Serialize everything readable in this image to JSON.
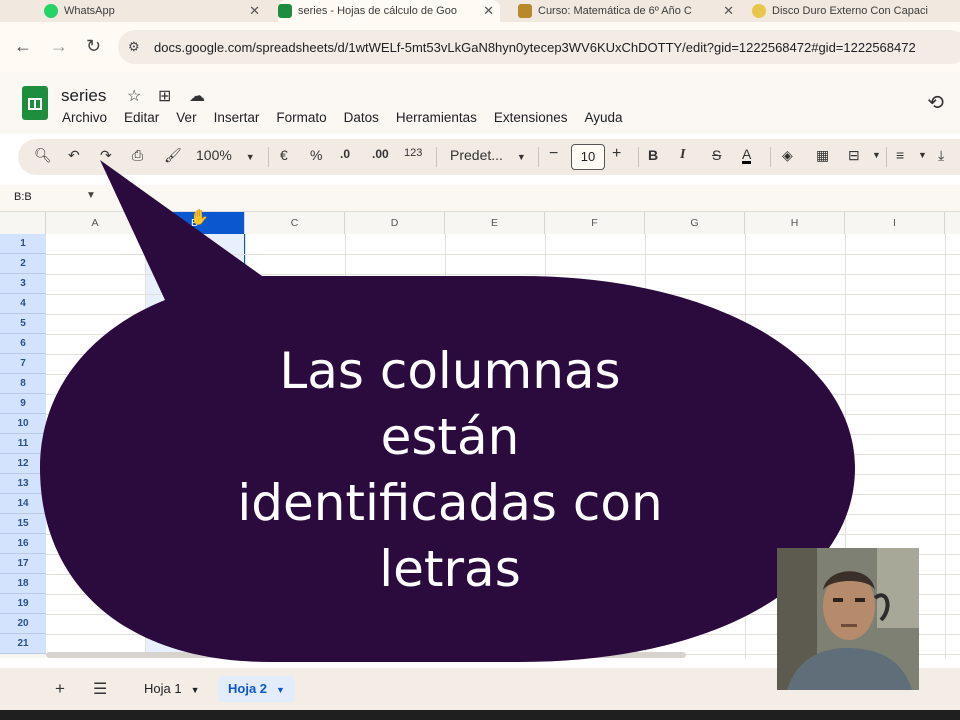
{
  "browser": {
    "tabs": [
      {
        "title": "WhatsApp",
        "icon_color": "#25d366"
      },
      {
        "title": "series - Hojas de cálculo de Goo",
        "icon_color": "#1e8e3e"
      },
      {
        "title": "Curso: Matemática de 6º Año C",
        "icon_color": "#b7892c"
      },
      {
        "title": "Disco Duro Externo Con Capaci",
        "icon_color": "#e8c64a"
      }
    ],
    "url": "docs.google.com/spreadsheets/d/1wtWELf-5mt53vLkGaN8hyn0ytecep3WV6KUxChDOTTY/edit?gid=1222568472#gid=1222568472"
  },
  "doc": {
    "title": "series",
    "menu": [
      "Archivo",
      "Editar",
      "Ver",
      "Insertar",
      "Formato",
      "Datos",
      "Herramientas",
      "Extensiones",
      "Ayuda"
    ]
  },
  "toolbar": {
    "zoom": "100%",
    "currency": "€",
    "percent": "%",
    "dec_decrease": ".0",
    "dec_increase": ".00",
    "number_format": "123",
    "font": "Predet...",
    "font_size": "10",
    "bold": "B",
    "italic": "I",
    "strike": "S",
    "text_color": "A"
  },
  "namebox": "B:B",
  "grid": {
    "columns": [
      "A",
      "B",
      "C",
      "D",
      "E",
      "F",
      "G",
      "H",
      "I"
    ],
    "selected_column": "B",
    "rows": [
      "1",
      "2",
      "3",
      "4",
      "5",
      "6",
      "7",
      "8",
      "9",
      "10",
      "11",
      "12",
      "13",
      "14",
      "15",
      "16",
      "17",
      "18",
      "19",
      "20",
      "21"
    ]
  },
  "sheets": [
    {
      "name": "Hoja 1",
      "active": false
    },
    {
      "name": "Hoja 2",
      "active": true
    }
  ],
  "overlay": {
    "caption_lines": [
      "Las columnas",
      "están",
      "identificadas con",
      "letras"
    ],
    "bubble_color": "#2b0a3d"
  },
  "colors": {
    "selection": "#0b57d0",
    "row_header_selected": "#d3e3fd",
    "sheets_green": "#1e8e3e"
  }
}
